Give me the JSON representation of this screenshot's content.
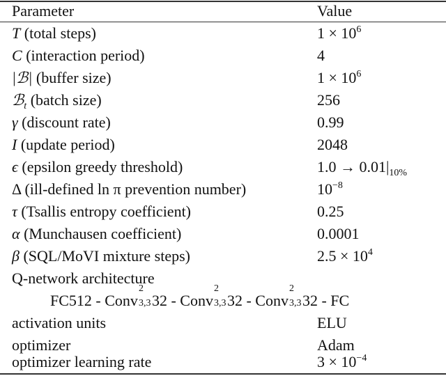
{
  "table": {
    "headers": {
      "parameter": "Parameter",
      "value": "Value"
    },
    "rows": [
      {
        "symbol": "T",
        "label": " (total steps)",
        "value_base": "1 × 10",
        "value_sup": "6"
      },
      {
        "symbol": "C",
        "label": " (interaction period)",
        "value": "4"
      },
      {
        "symbol": "|ℬ|",
        "label": " (buffer size)",
        "value_base": "1 × 10",
        "value_sup": "6"
      },
      {
        "symbol": "ℬ",
        "symbol_sub": "t",
        "label": " (batch size)",
        "value": "256"
      },
      {
        "symbol": "γ",
        "label": " (discount rate)",
        "value": "0.99"
      },
      {
        "symbol": "I",
        "label": " (update period)",
        "value": "2048"
      },
      {
        "symbol": "ϵ",
        "label": " (epsilon greedy threshold)",
        "value_base": "1.0 → 0.01|",
        "value_sub": "10%"
      },
      {
        "symbol": "Δ",
        "label": " (ill-defined ln π prevention number)",
        "value_base": "10",
        "value_sup": "−8"
      },
      {
        "symbol": "τ",
        "label": " (Tsallis entropy coefficient)",
        "value": "0.25"
      },
      {
        "symbol": "α",
        "label": " (Munchausen coefficient)",
        "value": "0.0001"
      },
      {
        "symbol": "β",
        "label": " (SQL/MoVI mixture steps)",
        "value_base": "2.5 × 10",
        "value_sup": "4"
      },
      {
        "label": "Q-network architecture"
      },
      {
        "architecture": {
          "fc_in": "FC512 - ",
          "conv": "Conv",
          "conv_sup": "2",
          "conv_sub": "3,3",
          "conv_out": "32",
          "sep": " - ",
          "fc_out": "FC"
        }
      },
      {
        "label": "activation units",
        "value": "ELU"
      },
      {
        "label": "optimizer",
        "value": "Adam"
      },
      {
        "label": "optimizer learning rate",
        "value_base": "3 × 10",
        "value_sup": "−4"
      }
    ]
  }
}
